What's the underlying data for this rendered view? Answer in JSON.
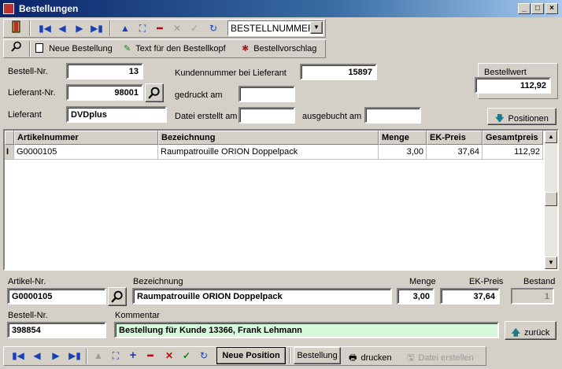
{
  "window": {
    "title": "Bestellungen"
  },
  "toolbar1": {
    "sort_select": "BESTELLNUMMER"
  },
  "toolbar2": {
    "neue_bestellung": "Neue Bestellung",
    "text_bestellkopf": "Text für den Bestellkopf",
    "bestellvorschlag": "Bestellvorschlag"
  },
  "header": {
    "bestell_nr_label": "Bestell-Nr.",
    "bestell_nr": "13",
    "lieferant_nr_label": "Lieferant-Nr.",
    "lieferant_nr": "98001",
    "lieferant_label": "Lieferant",
    "lieferant": "DVDplus",
    "kundennummer_label": "Kundennummer bei Lieferant",
    "kundennummer": "15897",
    "gedruckt_label": "gedruckt am",
    "gedruckt": "",
    "datei_label": "Datei erstellt am",
    "datei": "",
    "ausgebucht_label": "ausgebucht am",
    "ausgebucht": "",
    "bestellwert_label": "Bestellwert",
    "bestellwert": "112,92",
    "positionen_button": "Positionen"
  },
  "grid": {
    "columns": [
      "Artikelnummer",
      "Bezeichnung",
      "Menge",
      "EK-Preis",
      "Gesamtpreis"
    ],
    "rows": [
      {
        "marker": "I",
        "artikelnummer": "G0000105",
        "bezeichnung": "Raumpatrouille ORION Doppelpack",
        "menge": "3,00",
        "ek_preis": "37,64",
        "gesamtpreis": "112,92"
      }
    ]
  },
  "detail": {
    "artikel_nr_label": "Artikel-Nr.",
    "artikel_nr": "G0000105",
    "bezeichnung_label": "Bezeichnung",
    "bezeichnung": "Raumpatrouille ORION Doppelpack",
    "menge_label": "Menge",
    "menge": "3,00",
    "ek_preis_label": "EK-Preis",
    "ek_preis": "37,64",
    "bestand_label": "Bestand",
    "bestand": "1",
    "bestell_nr_label": "Bestell-Nr.",
    "bestell_nr": "398854",
    "kommentar_label": "Kommentar",
    "kommentar": "Bestellung für Kunde 13366, Frank Lehmann",
    "zurueck_button": "zurück"
  },
  "bottom_toolbar": {
    "neue_position": "Neue Position",
    "bestellung": "Bestellung",
    "drucken": "drucken",
    "datei_erstellen": "Datei erstellen"
  }
}
